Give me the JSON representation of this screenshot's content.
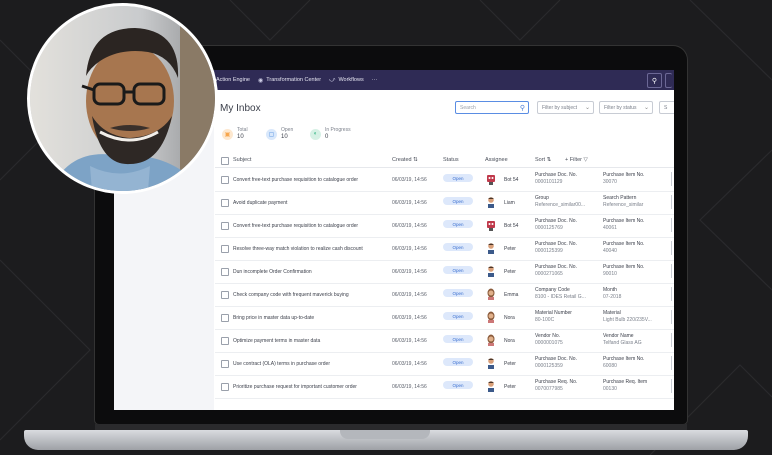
{
  "nav": {
    "items": [
      {
        "label": "Action Engine",
        "icon": "none"
      },
      {
        "label": "Transformation Center",
        "icon": "globe-icon"
      },
      {
        "label": "Workflows",
        "icon": "workflow-icon"
      },
      {
        "label": "···",
        "icon": "none"
      }
    ]
  },
  "page": {
    "title": "My Inbox"
  },
  "search": {
    "placeholder": "Search"
  },
  "filters": {
    "subject": "Filter by subject",
    "status": "Filter by status",
    "third": "S"
  },
  "stats": [
    {
      "label": "Total",
      "value": "10",
      "color": "#f7a64c"
    },
    {
      "label": "Open",
      "value": "10",
      "color": "#4a8ce0"
    },
    {
      "label": "In Progress",
      "value": "0",
      "color": "#3fb98a"
    }
  ],
  "table": {
    "headers": {
      "subject": "Subject",
      "created": "Created",
      "status": "Status",
      "assignee": "Assignee",
      "sort": "Sort",
      "filter": "+ Filter"
    },
    "rows": [
      {
        "subject": "Convert free-text purchase requisition to catalogue order",
        "created": "06/03/19, 14:56",
        "status": "Open",
        "assignee": "Bot 54",
        "avatar": "bot",
        "f1_label": "Purchase Doc. No.",
        "f1_value": "0000101129",
        "f2_label": "Purchase Item No.",
        "f2_value": "30070"
      },
      {
        "subject": "Avoid duplicate payment",
        "created": "06/03/19, 14:56",
        "status": "Open",
        "assignee": "Liam",
        "avatar": "person",
        "f1_label": "Group",
        "f1_value": "Reference_similar00...",
        "f2_label": "Search Pattern",
        "f2_value": "Reference_similar"
      },
      {
        "subject": "Convert free-text purchase requisition to catalogue order",
        "created": "06/03/19, 14:56",
        "status": "Open",
        "assignee": "Bot 54",
        "avatar": "bot",
        "f1_label": "Purchase Doc. No.",
        "f1_value": "0000125769",
        "f2_label": "Purchase Item No.",
        "f2_value": "40061"
      },
      {
        "subject": "Resolve three-way match violation to realize cash discount",
        "created": "06/03/19, 14:56",
        "status": "Open",
        "assignee": "Peter",
        "avatar": "person",
        "f1_label": "Purchase Doc. No.",
        "f1_value": "0000125399",
        "f2_label": "Purchase Item No.",
        "f2_value": "40040"
      },
      {
        "subject": "Dun incomplete Order Confirmation",
        "created": "06/03/19, 14:56",
        "status": "Open",
        "assignee": "Peter",
        "avatar": "person",
        "f1_label": "Purchase Doc. No.",
        "f1_value": "0000271065",
        "f2_label": "Purchase Item No.",
        "f2_value": "90010"
      },
      {
        "subject": "Check company code with frequent maverick buying",
        "created": "06/03/19, 14:56",
        "status": "Open",
        "assignee": "Emma",
        "avatar": "woman",
        "f1_label": "Company Code",
        "f1_value": "8100 - IDES Retail G...",
        "f2_label": "Month",
        "f2_value": "07-2018"
      },
      {
        "subject": "Bring price in master data up-to-date",
        "created": "06/03/19, 14:56",
        "status": "Open",
        "assignee": "Nora",
        "avatar": "woman",
        "f1_label": "Material Number",
        "f1_value": "80-100C",
        "f2_label": "Material",
        "f2_value": "Light Bulb 220/235V..."
      },
      {
        "subject": "Optimize payment terms in master data",
        "created": "06/03/19, 14:56",
        "status": "Open",
        "assignee": "Nora",
        "avatar": "woman",
        "f1_label": "Vendor No.",
        "f1_value": "0000001075",
        "f2_label": "Vendor Name",
        "f2_value": "Telfand Glass AG"
      },
      {
        "subject": "Use contract (OLA) terms in purchase order",
        "created": "06/03/19, 14:56",
        "status": "Open",
        "assignee": "Peter",
        "avatar": "person",
        "f1_label": "Purchase Doc. No.",
        "f1_value": "0000125359",
        "f2_label": "Purchase Item No.",
        "f2_value": "60080"
      },
      {
        "subject": "Prioritize purchase request for important customer order",
        "created": "06/03/19, 14:56",
        "status": "Open",
        "assignee": "Peter",
        "avatar": "person",
        "f1_label": "Purchase Req. No.",
        "f1_value": "0070077985",
        "f2_label": "Purchase Req. Item",
        "f2_value": "00130"
      }
    ]
  }
}
